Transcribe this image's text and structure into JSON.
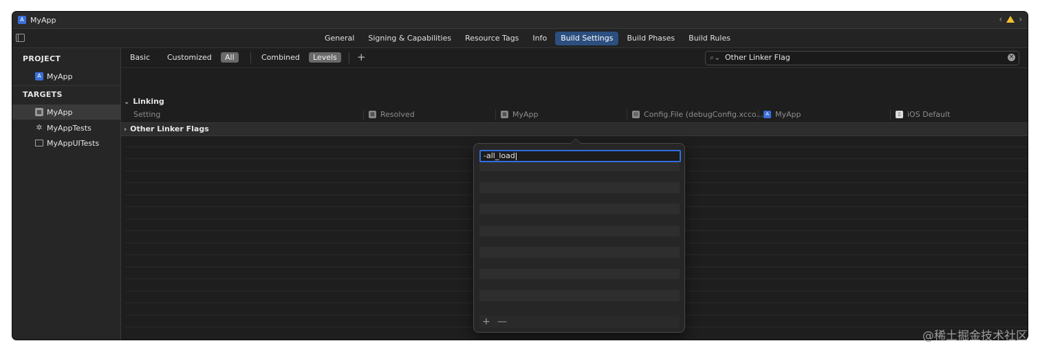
{
  "window": {
    "title": "MyApp"
  },
  "tabs": [
    {
      "label": "General",
      "active": false
    },
    {
      "label": "Signing & Capabilities",
      "active": false
    },
    {
      "label": "Resource Tags",
      "active": false
    },
    {
      "label": "Info",
      "active": false
    },
    {
      "label": "Build Settings",
      "active": true
    },
    {
      "label": "Build Phases",
      "active": false
    },
    {
      "label": "Build Rules",
      "active": false
    }
  ],
  "sidebar": {
    "project_header": "PROJECT",
    "project_item": "MyApp",
    "targets_header": "TARGETS",
    "targets": [
      {
        "label": "MyApp",
        "icon": "app-target-icon"
      },
      {
        "label": "MyAppTests",
        "icon": "gear-icon"
      },
      {
        "label": "MyAppUITests",
        "icon": "monitor-icon"
      }
    ]
  },
  "filters": {
    "basic": "Basic",
    "customized": "Customized",
    "all": "All",
    "combined": "Combined",
    "levels": "Levels",
    "add": "+"
  },
  "search": {
    "value": "Other Linker Flag"
  },
  "section": {
    "title": "Linking"
  },
  "columns": {
    "setting": "Setting",
    "resolved": "Resolved",
    "target": "MyApp",
    "config": "Config.File (debugConfig.xcco...",
    "project": "MyApp",
    "default": "iOS Default"
  },
  "setting_row": {
    "label": "Other Linker Flags"
  },
  "popover": {
    "value": "-all_load",
    "add": "+",
    "remove": "—"
  },
  "watermark": "@稀土掘金技术社区",
  "colors": {
    "accent": "#2c4f7f",
    "focus": "#2f6fe0",
    "warning": "#f2c12e"
  }
}
